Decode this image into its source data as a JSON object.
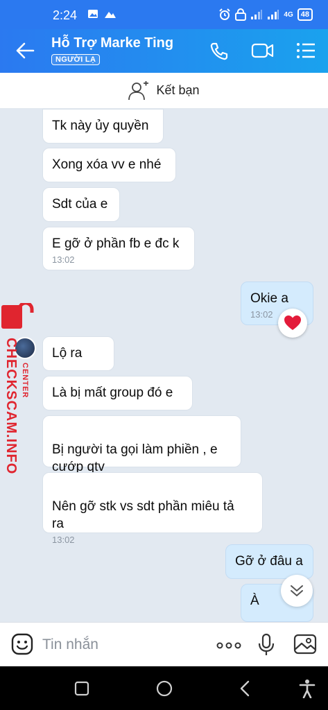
{
  "status": {
    "time": "2:24",
    "network": "4G",
    "battery": "48"
  },
  "header": {
    "title": "Hỗ Trợ Marke Ting",
    "badge": "NGƯỜI LẠ"
  },
  "add_friend": {
    "label": "Kết bạn"
  },
  "messages": [
    {
      "text": "Tk này ủy quyền"
    },
    {
      "text": "Xong xóa vv e nhé"
    },
    {
      "text": "Sdt của e"
    },
    {
      "text": "E gỡ ở phần fb e đc k",
      "time": "13:02"
    },
    {
      "text": "Okie a",
      "time": "13:02"
    },
    {
      "text": "Lộ ra"
    },
    {
      "text": "Là bị mất group đó e"
    },
    {
      "text": "Bị người ta gọi làm phiền , e\ncướp qtv"
    },
    {
      "text": "Nên gỡ stk vs sdt phần miêu tả\nra",
      "time": "13:02"
    },
    {
      "text": "Gỡ ở đâu a"
    },
    {
      "text": "À"
    }
  ],
  "watermark": {
    "main": "CHECKSCAM.INFO",
    "sub": "CENTER"
  },
  "input": {
    "placeholder": "Tin nhắn"
  },
  "colors": {
    "header": "#2b79f0",
    "outgoing_bubble": "#d4ebfd",
    "chat_bg": "#e2e9f1",
    "watermark": "#e0252f"
  }
}
